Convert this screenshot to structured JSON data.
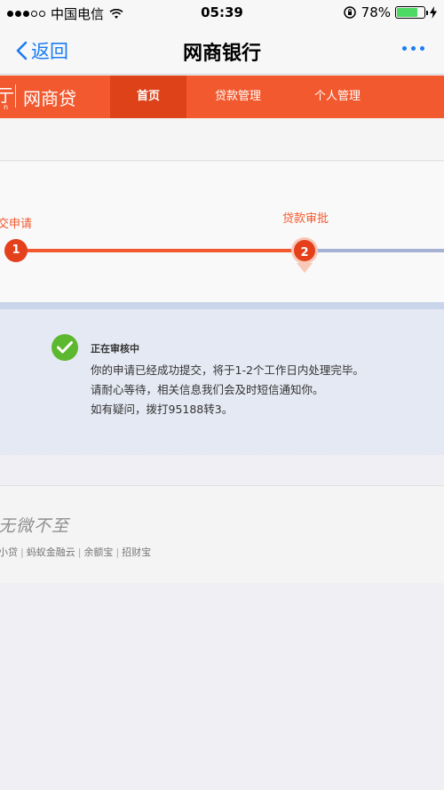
{
  "status_bar": {
    "carrier": "中国电信",
    "time": "05:39",
    "battery": "78%",
    "battery_level": 0.78
  },
  "nav": {
    "back_label": "返回",
    "title": "网商银行"
  },
  "brand": {
    "partial_text": "亍",
    "sub_partial": "n",
    "name": "网商贷",
    "tabs": [
      "首页",
      "贷款管理",
      "个人管理"
    ]
  },
  "progress": {
    "steps": [
      {
        "number": "1",
        "label": "提交申请"
      },
      {
        "number": "2",
        "label": "贷款审批"
      }
    ]
  },
  "message": {
    "title": "正在审核中",
    "lines": [
      "你的申请已经成功提交，将于1-2个工作日内处理完毕。",
      "请耐心等待，相关信息我们会及时短信通知你。",
      "如有疑问，拨打95188转3。"
    ]
  },
  "footer": {
    "slogan": "无微不至",
    "links": [
      "小贷",
      "蚂蚁金融云",
      "余额宝",
      "招财宝"
    ]
  },
  "colors": {
    "brand_orange": "#f2592e",
    "active_tab": "#de4219",
    "link_blue": "#1a7cf2",
    "success_green": "#5cb82e"
  }
}
